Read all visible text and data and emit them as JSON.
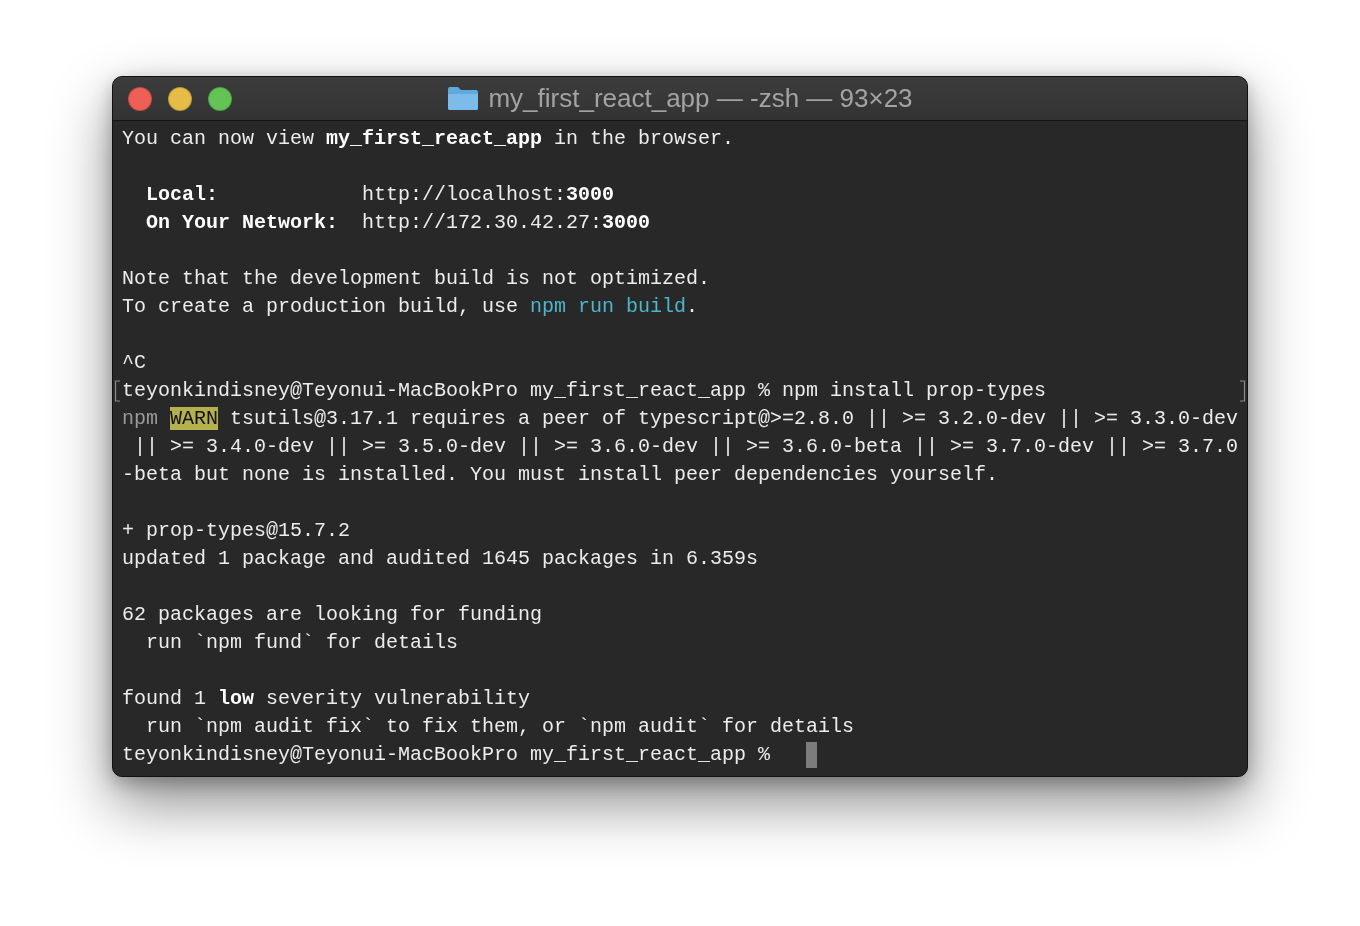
{
  "window": {
    "title": "my_first_react_app — -zsh — 93×23"
  },
  "terminal": {
    "blocks": [
      {
        "lines": [
          {
            "marked": false,
            "cursor": false,
            "segments": [
              {
                "kind": "plain",
                "text": "You can now view "
              },
              {
                "kind": "bold",
                "text": "my_first_react_app"
              },
              {
                "kind": "plain",
                "text": " in the browser."
              }
            ]
          }
        ]
      },
      {
        "lines": [
          {
            "marked": false,
            "cursor": false,
            "segments": [
              {
                "kind": "bold",
                "text": "  Local:"
              },
              {
                "kind": "plain",
                "text": "            http://localhost:"
              },
              {
                "kind": "bold",
                "text": "3000"
              }
            ]
          },
          {
            "marked": false,
            "cursor": false,
            "segments": [
              {
                "kind": "bold",
                "text": "  On Your Network:"
              },
              {
                "kind": "plain",
                "text": "  http://172.30.42.27:"
              },
              {
                "kind": "bold",
                "text": "3000"
              }
            ]
          }
        ]
      },
      {
        "lines": [
          {
            "marked": false,
            "cursor": false,
            "segments": [
              {
                "kind": "plain",
                "text": "Note that the development build is not optimized."
              }
            ]
          },
          {
            "marked": false,
            "cursor": false,
            "segments": [
              {
                "kind": "plain",
                "text": "To create a production build, use "
              },
              {
                "kind": "command",
                "text": "npm run build"
              },
              {
                "kind": "plain",
                "text": "."
              }
            ]
          }
        ]
      },
      {
        "lines": [
          {
            "marked": false,
            "cursor": false,
            "segments": [
              {
                "kind": "plain",
                "text": "^C"
              }
            ]
          },
          {
            "marked": true,
            "cursor": false,
            "segments": [
              {
                "kind": "plain",
                "text": "teyonkindisney@Teyonui-MacBookPro my_first_react_app % npm install prop-types"
              }
            ]
          },
          {
            "marked": false,
            "cursor": false,
            "segments": [
              {
                "kind": "dim",
                "text": "npm "
              },
              {
                "kind": "warn",
                "text": "WARN"
              },
              {
                "kind": "plain",
                "text": " tsutils@3.17.1 requires a peer of typescript@>=2.8.0 || >= 3.2.0-dev || >= 3.3.0-dev || >= 3.4.0-dev || >= 3.5.0-dev || >= 3.6.0-dev || >= 3.6.0-beta || >= 3.7.0-dev || >= 3.7.0-beta but none is installed. You must install peer dependencies yourself."
              }
            ]
          }
        ]
      },
      {
        "lines": [
          {
            "marked": false,
            "cursor": false,
            "segments": [
              {
                "kind": "plain",
                "text": "+ prop-types@15.7.2"
              }
            ]
          },
          {
            "marked": false,
            "cursor": false,
            "segments": [
              {
                "kind": "plain",
                "text": "updated 1 package and audited 1645 packages in 6.359s"
              }
            ]
          }
        ]
      },
      {
        "lines": [
          {
            "marked": false,
            "cursor": false,
            "segments": [
              {
                "kind": "plain",
                "text": "62 packages are looking for funding"
              }
            ]
          },
          {
            "marked": false,
            "cursor": false,
            "segments": [
              {
                "kind": "plain",
                "text": "  run `npm fund` for details"
              }
            ]
          }
        ]
      },
      {
        "lines": [
          {
            "marked": false,
            "cursor": false,
            "segments": [
              {
                "kind": "plain",
                "text": "found 1 "
              },
              {
                "kind": "bold",
                "text": "low"
              },
              {
                "kind": "plain",
                "text": " severity vulnerability"
              }
            ]
          },
          {
            "marked": false,
            "cursor": false,
            "segments": [
              {
                "kind": "plain",
                "text": "  run `npm audit fix` to fix them, or `npm audit` for details"
              }
            ]
          },
          {
            "marked": false,
            "cursor": true,
            "segments": [
              {
                "kind": "plain",
                "text": "teyonkindisney@Teyonui-MacBookPro my_first_react_app %"
              }
            ]
          }
        ]
      }
    ]
  }
}
